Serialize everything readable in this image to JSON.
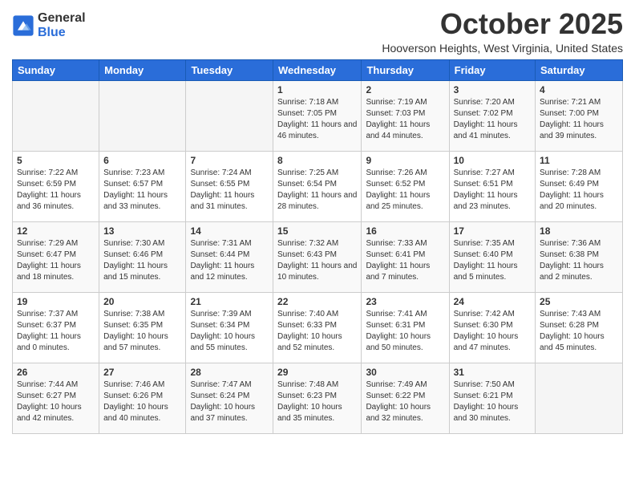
{
  "logo": {
    "general": "General",
    "blue": "Blue"
  },
  "title": "October 2025",
  "location": "Hooverson Heights, West Virginia, United States",
  "headers": [
    "Sunday",
    "Monday",
    "Tuesday",
    "Wednesday",
    "Thursday",
    "Friday",
    "Saturday"
  ],
  "weeks": [
    [
      {
        "date": "",
        "sunrise": "",
        "sunset": "",
        "daylight": ""
      },
      {
        "date": "",
        "sunrise": "",
        "sunset": "",
        "daylight": ""
      },
      {
        "date": "",
        "sunrise": "",
        "sunset": "",
        "daylight": ""
      },
      {
        "date": "1",
        "sunrise": "Sunrise: 7:18 AM",
        "sunset": "Sunset: 7:05 PM",
        "daylight": "Daylight: 11 hours and 46 minutes."
      },
      {
        "date": "2",
        "sunrise": "Sunrise: 7:19 AM",
        "sunset": "Sunset: 7:03 PM",
        "daylight": "Daylight: 11 hours and 44 minutes."
      },
      {
        "date": "3",
        "sunrise": "Sunrise: 7:20 AM",
        "sunset": "Sunset: 7:02 PM",
        "daylight": "Daylight: 11 hours and 41 minutes."
      },
      {
        "date": "4",
        "sunrise": "Sunrise: 7:21 AM",
        "sunset": "Sunset: 7:00 PM",
        "daylight": "Daylight: 11 hours and 39 minutes."
      }
    ],
    [
      {
        "date": "5",
        "sunrise": "Sunrise: 7:22 AM",
        "sunset": "Sunset: 6:59 PM",
        "daylight": "Daylight: 11 hours and 36 minutes."
      },
      {
        "date": "6",
        "sunrise": "Sunrise: 7:23 AM",
        "sunset": "Sunset: 6:57 PM",
        "daylight": "Daylight: 11 hours and 33 minutes."
      },
      {
        "date": "7",
        "sunrise": "Sunrise: 7:24 AM",
        "sunset": "Sunset: 6:55 PM",
        "daylight": "Daylight: 11 hours and 31 minutes."
      },
      {
        "date": "8",
        "sunrise": "Sunrise: 7:25 AM",
        "sunset": "Sunset: 6:54 PM",
        "daylight": "Daylight: 11 hours and 28 minutes."
      },
      {
        "date": "9",
        "sunrise": "Sunrise: 7:26 AM",
        "sunset": "Sunset: 6:52 PM",
        "daylight": "Daylight: 11 hours and 25 minutes."
      },
      {
        "date": "10",
        "sunrise": "Sunrise: 7:27 AM",
        "sunset": "Sunset: 6:51 PM",
        "daylight": "Daylight: 11 hours and 23 minutes."
      },
      {
        "date": "11",
        "sunrise": "Sunrise: 7:28 AM",
        "sunset": "Sunset: 6:49 PM",
        "daylight": "Daylight: 11 hours and 20 minutes."
      }
    ],
    [
      {
        "date": "12",
        "sunrise": "Sunrise: 7:29 AM",
        "sunset": "Sunset: 6:47 PM",
        "daylight": "Daylight: 11 hours and 18 minutes."
      },
      {
        "date": "13",
        "sunrise": "Sunrise: 7:30 AM",
        "sunset": "Sunset: 6:46 PM",
        "daylight": "Daylight: 11 hours and 15 minutes."
      },
      {
        "date": "14",
        "sunrise": "Sunrise: 7:31 AM",
        "sunset": "Sunset: 6:44 PM",
        "daylight": "Daylight: 11 hours and 12 minutes."
      },
      {
        "date": "15",
        "sunrise": "Sunrise: 7:32 AM",
        "sunset": "Sunset: 6:43 PM",
        "daylight": "Daylight: 11 hours and 10 minutes."
      },
      {
        "date": "16",
        "sunrise": "Sunrise: 7:33 AM",
        "sunset": "Sunset: 6:41 PM",
        "daylight": "Daylight: 11 hours and 7 minutes."
      },
      {
        "date": "17",
        "sunrise": "Sunrise: 7:35 AM",
        "sunset": "Sunset: 6:40 PM",
        "daylight": "Daylight: 11 hours and 5 minutes."
      },
      {
        "date": "18",
        "sunrise": "Sunrise: 7:36 AM",
        "sunset": "Sunset: 6:38 PM",
        "daylight": "Daylight: 11 hours and 2 minutes."
      }
    ],
    [
      {
        "date": "19",
        "sunrise": "Sunrise: 7:37 AM",
        "sunset": "Sunset: 6:37 PM",
        "daylight": "Daylight: 11 hours and 0 minutes."
      },
      {
        "date": "20",
        "sunrise": "Sunrise: 7:38 AM",
        "sunset": "Sunset: 6:35 PM",
        "daylight": "Daylight: 10 hours and 57 minutes."
      },
      {
        "date": "21",
        "sunrise": "Sunrise: 7:39 AM",
        "sunset": "Sunset: 6:34 PM",
        "daylight": "Daylight: 10 hours and 55 minutes."
      },
      {
        "date": "22",
        "sunrise": "Sunrise: 7:40 AM",
        "sunset": "Sunset: 6:33 PM",
        "daylight": "Daylight: 10 hours and 52 minutes."
      },
      {
        "date": "23",
        "sunrise": "Sunrise: 7:41 AM",
        "sunset": "Sunset: 6:31 PM",
        "daylight": "Daylight: 10 hours and 50 minutes."
      },
      {
        "date": "24",
        "sunrise": "Sunrise: 7:42 AM",
        "sunset": "Sunset: 6:30 PM",
        "daylight": "Daylight: 10 hours and 47 minutes."
      },
      {
        "date": "25",
        "sunrise": "Sunrise: 7:43 AM",
        "sunset": "Sunset: 6:28 PM",
        "daylight": "Daylight: 10 hours and 45 minutes."
      }
    ],
    [
      {
        "date": "26",
        "sunrise": "Sunrise: 7:44 AM",
        "sunset": "Sunset: 6:27 PM",
        "daylight": "Daylight: 10 hours and 42 minutes."
      },
      {
        "date": "27",
        "sunrise": "Sunrise: 7:46 AM",
        "sunset": "Sunset: 6:26 PM",
        "daylight": "Daylight: 10 hours and 40 minutes."
      },
      {
        "date": "28",
        "sunrise": "Sunrise: 7:47 AM",
        "sunset": "Sunset: 6:24 PM",
        "daylight": "Daylight: 10 hours and 37 minutes."
      },
      {
        "date": "29",
        "sunrise": "Sunrise: 7:48 AM",
        "sunset": "Sunset: 6:23 PM",
        "daylight": "Daylight: 10 hours and 35 minutes."
      },
      {
        "date": "30",
        "sunrise": "Sunrise: 7:49 AM",
        "sunset": "Sunset: 6:22 PM",
        "daylight": "Daylight: 10 hours and 32 minutes."
      },
      {
        "date": "31",
        "sunrise": "Sunrise: 7:50 AM",
        "sunset": "Sunset: 6:21 PM",
        "daylight": "Daylight: 10 hours and 30 minutes."
      },
      {
        "date": "",
        "sunrise": "",
        "sunset": "",
        "daylight": ""
      }
    ]
  ]
}
